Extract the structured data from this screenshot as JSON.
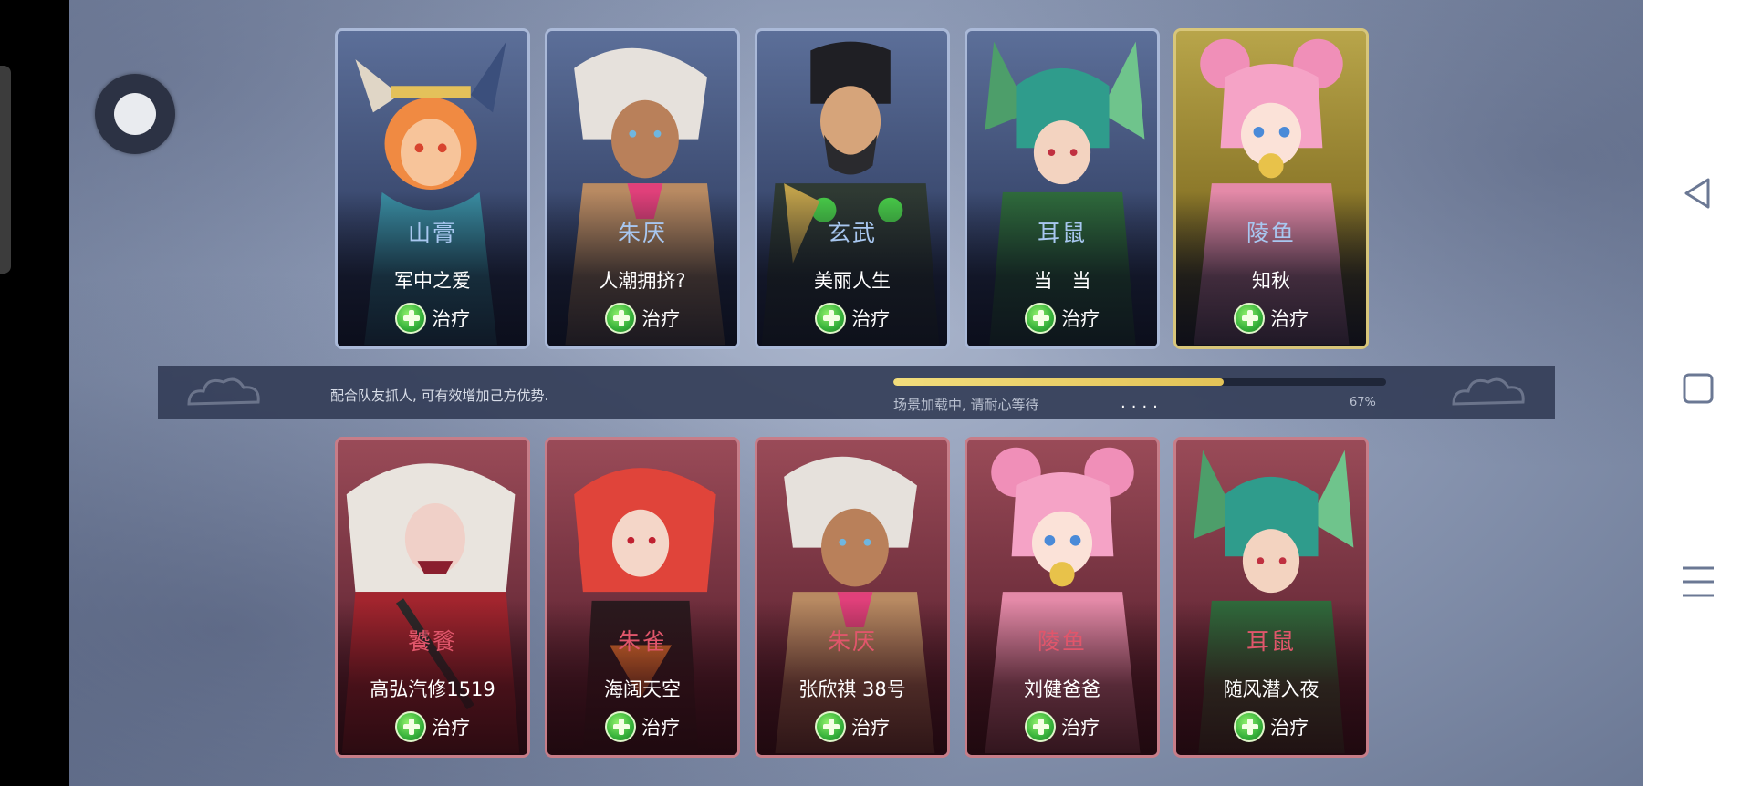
{
  "team_top": [
    {
      "hero": "山膏",
      "player": "军中之爱",
      "role": "治疗",
      "frame": "blue"
    },
    {
      "hero": "朱厌",
      "player": "人潮拥挤?",
      "role": "治疗",
      "frame": "blue"
    },
    {
      "hero": "玄武",
      "player": "美丽人生",
      "role": "治疗",
      "frame": "blue"
    },
    {
      "hero": "耳鼠",
      "player": "当　当",
      "role": "治疗",
      "frame": "blue"
    },
    {
      "hero": "陵鱼",
      "player": "知秋",
      "role": "治疗",
      "frame": "gold"
    }
  ],
  "team_bottom": [
    {
      "hero": "饕餮",
      "player": "高弘汽修1519",
      "role": "治疗",
      "frame": "red"
    },
    {
      "hero": "朱雀",
      "player": "海阔天空",
      "role": "治疗",
      "frame": "red"
    },
    {
      "hero": "朱厌",
      "player": "张欣祺 38号",
      "role": "治疗",
      "frame": "red"
    },
    {
      "hero": "陵鱼",
      "player": "刘健爸爸",
      "role": "治疗",
      "frame": "red"
    },
    {
      "hero": "耳鼠",
      "player": "随风潜入夜",
      "role": "治疗",
      "frame": "red"
    }
  ],
  "loading": {
    "tip": "配合队友抓人, 可有效增加己方优势.",
    "status": "场景加载中, 请耐心等待",
    "dots": "....",
    "percent_label": "67%",
    "progress": 0.67
  },
  "icons": {
    "role_icon": "green-cross-icon",
    "float_ball": "assistive-touch-icon",
    "nav_back": "back-triangle-icon",
    "nav_home": "home-square-icon",
    "nav_menu": "menu-lines-icon"
  },
  "colors": {
    "accent_blue_frame": "#aab9d8",
    "accent_red_frame": "#c77d88",
    "accent_gold_frame": "#d8c67a",
    "progress_fill": "#e3c357",
    "heal_green": "#36b13a"
  }
}
